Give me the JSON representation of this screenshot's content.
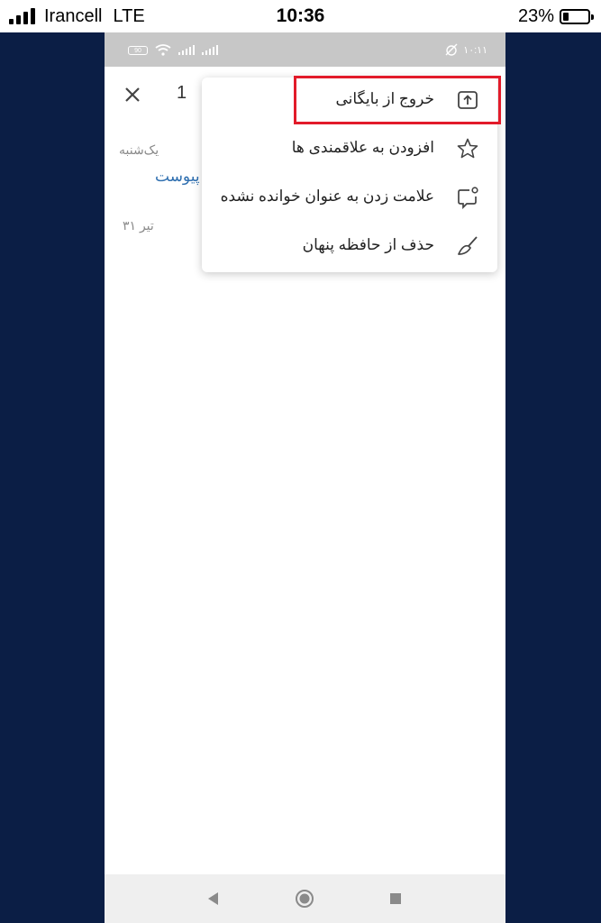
{
  "ios_status": {
    "carrier": "Irancell",
    "network": "LTE",
    "time": "10:36",
    "battery_percent": "23%",
    "battery_level": 0.23
  },
  "android_status": {
    "battery_label": "90",
    "time": "۱۰:۱۱"
  },
  "header": {
    "selected_count": "1"
  },
  "email": {
    "day_label": "یک‌شنبه",
    "attachment_text": "پیوست",
    "date_label": "۳۱ تیر"
  },
  "menu": {
    "items": [
      {
        "label": "خروج از بایگانی",
        "icon": "unarchive-icon"
      },
      {
        "label": "افزودن به علاقمندی ها",
        "icon": "star-icon"
      },
      {
        "label": "علامت زدن به عنوان خوانده نشده",
        "icon": "mark-unread-icon"
      },
      {
        "label": "حذف از حافظه پنهان",
        "icon": "broom-icon"
      }
    ]
  },
  "highlight_color": "#e21b2a",
  "background_color": "#0b1e45"
}
